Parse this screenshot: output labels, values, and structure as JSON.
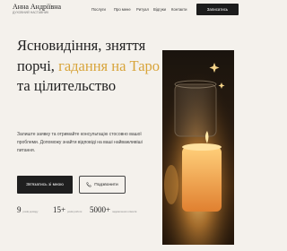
{
  "header": {
    "brand_name": "Анна Андріївна",
    "brand_tagline": "ДУХОВНИЙ НАСТАВНИК",
    "nav": [
      {
        "label": "Послуги"
      },
      {
        "label": "Про мене"
      },
      {
        "label": "Ритуал"
      },
      {
        "label": "Відгуки"
      },
      {
        "label": "Контакти"
      }
    ],
    "cta_label": "Записатись"
  },
  "hero": {
    "title_part1": "Ясновидіння, зняття порчі, ",
    "title_highlight": "гадання на Таро",
    "title_part2": " та цілительство",
    "description": "Залиште заявку та отримайте консультацію стосовно вашої проблеми. Допоможу знайти відповіді на ваші найважливіші питання.",
    "primary_button": "Зв'язатись зі мною",
    "secondary_button": "Подзвонити"
  },
  "stats": [
    {
      "value": "9",
      "label": "років досвіду"
    },
    {
      "value": "15+",
      "label": "років роботи"
    },
    {
      "value": "5000+",
      "label": "задоволених клієнтів"
    }
  ],
  "colors": {
    "accent": "#d8a43a",
    "dark": "#1f1f1f",
    "background": "#f4f1ec"
  }
}
